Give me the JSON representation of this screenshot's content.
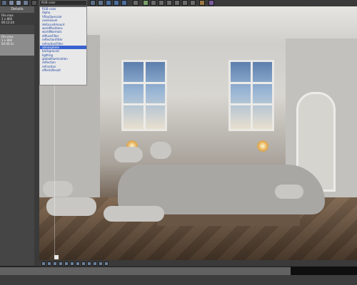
{
  "toolbar": {
    "channel_dropdown_value": "RGB color"
  },
  "left_panel": {
    "tab_label": "Details",
    "info1_lines": [
      "File.max",
      "1 x 800",
      "00:12:24"
    ],
    "info2_lines": [
      "File.max",
      "1 x 800",
      "00:06:2s"
    ]
  },
  "channel_menu": {
    "items": [
      "RGB color",
      "Alpha",
      "VRaySpecular",
      "noiseLevel",
      "defocusAmount",
      "worldPositions",
      "worldNormals",
      "diffuseFilter",
      "reflectionFilter",
      "refractionFilter",
      "atmosphere",
      "background",
      "lighting",
      "globalIllumination",
      "reflection",
      "refraction",
      "effectsResult"
    ],
    "selected_index": 10
  },
  "colors": {
    "selection": "#3a63d0",
    "menu_text": "#1a40a0",
    "panel_bg": "#454545"
  }
}
